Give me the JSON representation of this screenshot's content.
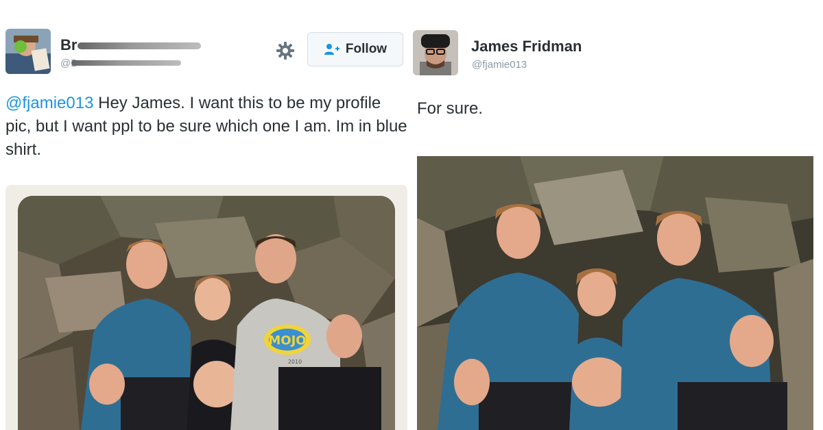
{
  "left_tweet": {
    "author_name_visible": "Br",
    "author_handle_visible": "@B",
    "follow_label": "Follow",
    "text_mention": "@fjamie013",
    "text_body": " Hey James. I want this to be my profile pic, but I want ppl to be sure which one I am. Im in blue shirt.",
    "photo_shirt_text": "MOJO",
    "photo_shirt_year": "2010"
  },
  "right_tweet": {
    "author_name": "James Fridman",
    "author_handle": "@fjamie013",
    "text": "For sure."
  },
  "colors": {
    "link": "#1b95e0",
    "text": "#292f33",
    "muted": "#8899a6",
    "blue_shirt": "#2f6e93"
  },
  "icons": {
    "settings": "gear-icon",
    "follow": "add-user-icon"
  }
}
